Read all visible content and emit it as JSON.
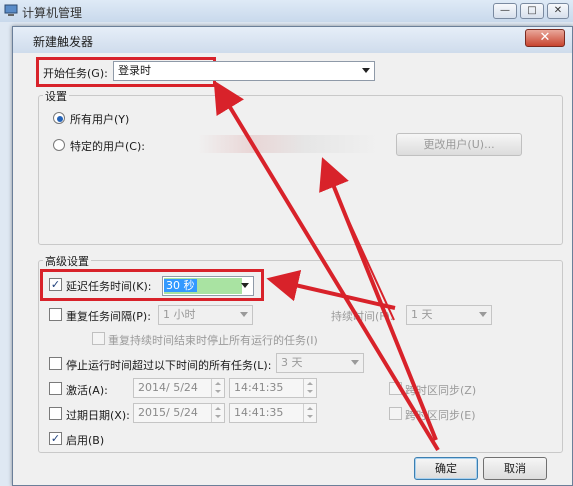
{
  "parent_window": {
    "title": "计算机管理"
  },
  "dialog": {
    "title": "新建触发器",
    "close_glyph": "✕",
    "begin_task": {
      "label": "开始任务(G):",
      "value": "登录时"
    },
    "settings": {
      "group_title": "设置",
      "all_users_label": "所有用户(Y)",
      "specific_user_label": "特定的用户(C):",
      "change_user_button": "更改用户(U)..."
    },
    "advanced": {
      "group_title": "高级设置",
      "delay_task": {
        "label": "延迟任务时间(K):",
        "value": "30 秒",
        "checked": true
      },
      "repeat_task": {
        "label": "重复任务间隔(P):",
        "value": "1 小时",
        "duration_label": "持续时间(F):",
        "duration_value": "1 天",
        "checked": false
      },
      "stop_repeat_label": "重复持续时间结束时停止所有运行的任务(I)",
      "stop_longer": {
        "label": "停止运行时间超过以下时间的所有任务(L):",
        "value": "3 天",
        "checked": false
      },
      "activate": {
        "label": "激活(A):",
        "date": "2014/ 5/24",
        "time": "14:41:35",
        "sync_label": "跨时区同步(Z)",
        "checked": false
      },
      "expire": {
        "label": "过期日期(X):",
        "date": "2015/ 5/24",
        "time": "14:41:35",
        "sync_label": "跨时区同步(E)",
        "checked": false
      },
      "enabled": {
        "label": "启用(B)",
        "checked": true
      }
    },
    "ok_button": "确定",
    "cancel_button": "取消"
  },
  "colors": {
    "highlight_red": "#d8222a",
    "selection_blue": "#3399ff",
    "value_bg_green": "#a9e3a2"
  }
}
